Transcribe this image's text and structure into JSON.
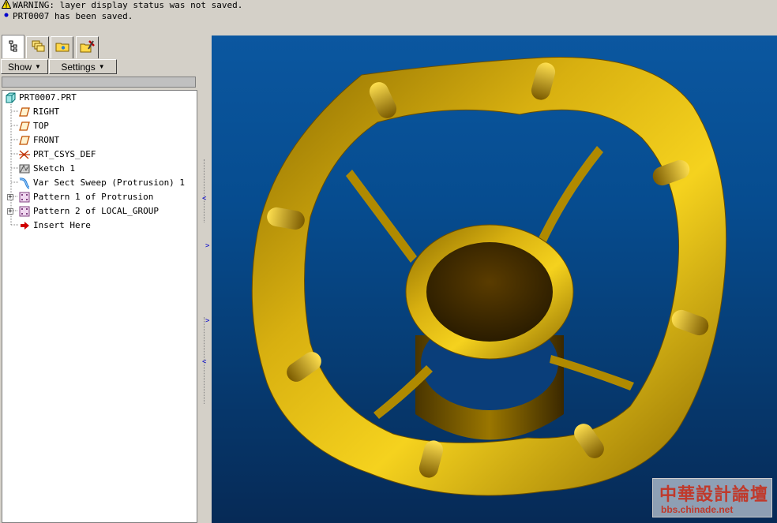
{
  "messages": [
    {
      "icon": "warning-icon",
      "text": "WARNING: layer display status was not saved."
    },
    {
      "icon": "info-dot-icon",
      "text": "PRT0007 has been saved."
    }
  ],
  "navigator": {
    "tabs": [
      "model-tree",
      "layer",
      "folder-browser",
      "favorites-connections"
    ],
    "show_label": "Show",
    "settings_label": "Settings"
  },
  "tree": {
    "root": "PRT0007.PRT",
    "items": [
      {
        "label": "RIGHT",
        "icon": "datum-plane-icon"
      },
      {
        "label": "TOP",
        "icon": "datum-plane-icon"
      },
      {
        "label": "FRONT",
        "icon": "datum-plane-icon"
      },
      {
        "label": "PRT_CSYS_DEF",
        "icon": "csys-icon"
      },
      {
        "label": "Sketch 1",
        "icon": "sketch-icon"
      },
      {
        "label": "Var Sect Sweep (Protrusion) 1",
        "icon": "sweep-icon"
      },
      {
        "label": "Pattern 1 of Protrusion",
        "icon": "pattern-icon",
        "expandable": true
      },
      {
        "label": "Pattern 2 of LOCAL_GROUP",
        "icon": "pattern-icon",
        "expandable": true
      },
      {
        "label": "Insert Here",
        "icon": "insert-arrow-icon"
      }
    ]
  },
  "watermark": {
    "chinese": "中華設計論壇",
    "url": "bbs.chinade.net"
  },
  "colors": {
    "viewport_top": "#0b57a0",
    "viewport_bottom": "#062a56",
    "part_gold": "#c9a000"
  }
}
